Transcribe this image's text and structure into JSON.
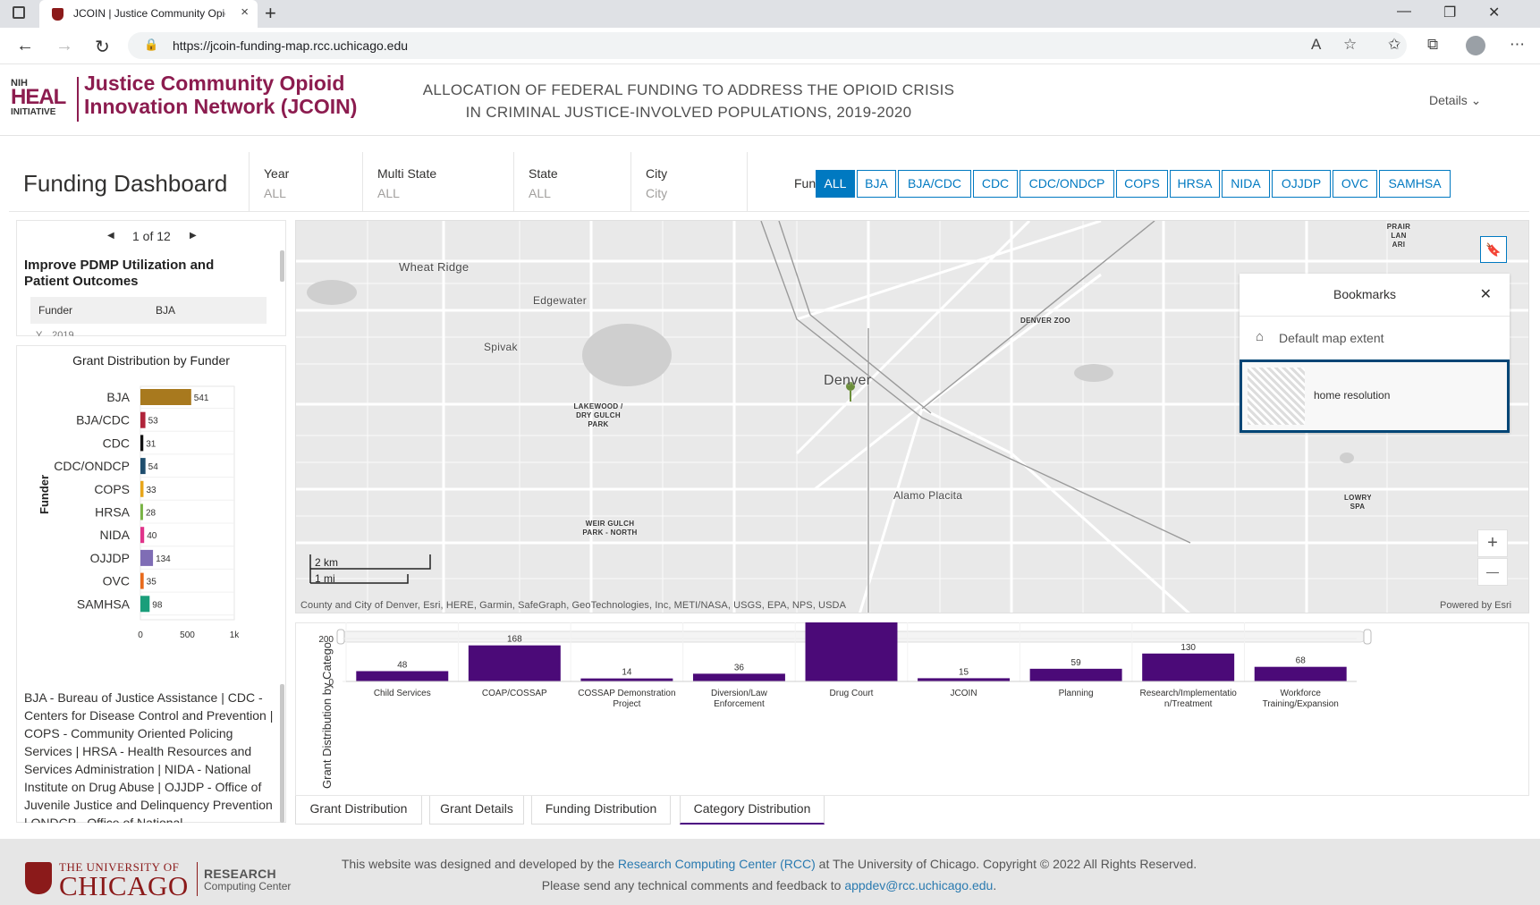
{
  "browser": {
    "tab_title": "JCOIN | Justice Community Opioid",
    "url": "https://jcoin-funding-map.rcc.uchicago.edu",
    "new_tab": "+",
    "minimize": "—",
    "restore": "❐",
    "close": "✕"
  },
  "header": {
    "nih": "NIH",
    "heal": "HEAL",
    "initiative": "INITIATIVE",
    "brand_title": "Justice Community Opioid Innovation Network (JCOIN)",
    "main_title": "ALLOCATION OF FEDERAL FUNDING TO ADDRESS THE OPIOID CRISIS IN CRIMINAL JUSTICE-INVOLVED POPULATIONS, 2019-2020",
    "details": "Details ⌄"
  },
  "dashboard": {
    "title": "Funding Dashboard",
    "filters": [
      {
        "label": "Year",
        "value": "ALL"
      },
      {
        "label": "Multi State",
        "value": "ALL"
      },
      {
        "label": "State",
        "value": "ALL"
      },
      {
        "label": "City",
        "value": "City"
      }
    ],
    "funder_label": "Funder",
    "funder_buttons": [
      "ALL",
      "BJA",
      "BJA/CDC",
      "CDC",
      "CDC/ONDCP",
      "COPS",
      "HRSA",
      "NIDA",
      "OJJDP",
      "OVC",
      "SAMHSA"
    ],
    "active_funder": "ALL"
  },
  "list_panel": {
    "pager": "1 of 12",
    "grant_title": "Improve PDMP Utilization and Patient Outcomes",
    "attr_key": "Funder",
    "attr_value": "BJA",
    "attr_cut": "Y...           2019"
  },
  "funder_chart": {
    "title": "Grant Distribution by Funder",
    "axis_label": "Funder",
    "legend_text": "BJA - Bureau of Justice Assistance | CDC - Centers for Disease Control and Prevention | COPS - Community Oriented Policing Services | HRSA - Health Resources and Services Administration | NIDA - National Institute on Drug Abuse | OJJDP - Office of Juvenile Justice and Delinquency Prevention | ONDCP - Office of National"
  },
  "map": {
    "labels": [
      "Wheat Ridge",
      "Edgewater",
      "Spivak",
      "Denver",
      "Alamo Placita"
    ],
    "small_labels": [
      "DENVER ZOO",
      "LAKEWOOD / DRY GULCH PARK",
      "WEIR GULCH PARK - NORTH",
      "LOWRY SPA",
      "PRAIR LAN ARI"
    ],
    "scale_km": "2 km",
    "scale_mi": "1 mi",
    "attribution": "County and City of Denver, Esri, HERE, Garmin, SafeGraph, GeoTechnologies, Inc, METI/NASA, USGS, EPA, NPS, USDA",
    "powered_by": "Powered by Esri",
    "zoom_in": "+",
    "zoom_out": "—"
  },
  "bookmarks": {
    "title": "Bookmarks",
    "close": "✕",
    "default": "Default map extent",
    "home": "home resolution"
  },
  "tabs": [
    "Grant Distribution",
    "Grant Details",
    "Funding Distribution",
    "Category Distribution"
  ],
  "active_tab": "Category Distribution",
  "footer": {
    "the": "THE UNIVERSITY OF",
    "chicago": "CHICAGO",
    "rcc1": "RESEARCH",
    "rcc2": "Computing Center",
    "line1_pre": "This website was designed and developed by the ",
    "line1_link": "Research Computing Center (RCC)",
    "line1_post": " at The University of Chicago. Copyright © 2022 All Rights Reserved.",
    "line2_pre": "Please send any technical comments and feedback to ",
    "line2_link": "appdev@rcc.uchicago.edu",
    "line2_post": "."
  },
  "colors": {
    "accent": "#0079c1",
    "brand": "#8c1c4f",
    "cat_bar": "#4b0a78"
  },
  "chart_data": [
    {
      "type": "bar",
      "orientation": "horizontal",
      "title": "Grant Distribution by Funder",
      "ylabel": "Funder",
      "xlabel": "",
      "categories": [
        "BJA",
        "BJA/CDC",
        "CDC",
        "CDC/ONDCP",
        "COPS",
        "HRSA",
        "NIDA",
        "OJJDP",
        "OVC",
        "SAMHSA"
      ],
      "values": [
        541,
        53,
        31,
        54,
        33,
        28,
        40,
        134,
        35,
        98
      ],
      "colors": [
        "#a8791e",
        "#b0243a",
        "#111111",
        "#1f4e6e",
        "#e8a61a",
        "#79b345",
        "#e0338a",
        "#7f6db5",
        "#e86a1c",
        "#1a9e7a"
      ],
      "xticks": [
        "0",
        "500",
        "1k"
      ],
      "xlim": [
        0,
        1000
      ],
      "grid": true
    },
    {
      "type": "bar",
      "title": "",
      "ylabel": "Grant Distribution by Catego",
      "xlabel": "",
      "categories": [
        "Child Services",
        "COAP/COSSAP",
        "COSSAP Demonstration Project",
        "Diversion/Law Enforcement",
        "Drug Court",
        "JCOIN",
        "Planning",
        "Research/Implementation/Treatment",
        "Workforce Training/Expansion"
      ],
      "category_lines": [
        [
          "Child Services"
        ],
        [
          "COAP/COSSAP"
        ],
        [
          "COSSAP Demonstration",
          "Project"
        ],
        [
          "Diversion/Law",
          "Enforcement"
        ],
        [
          "Drug Court"
        ],
        [
          "JCOIN"
        ],
        [
          "Planning"
        ],
        [
          "Research/Implementatio",
          "n/Treatment"
        ],
        [
          "Workforce",
          "Training/Expansion"
        ]
      ],
      "values": [
        48,
        168,
        14,
        36,
        305,
        15,
        59,
        130,
        68
      ],
      "yticks": [
        "0",
        "200",
        "400"
      ],
      "ylim": [
        0,
        400
      ],
      "grid": true
    }
  ]
}
